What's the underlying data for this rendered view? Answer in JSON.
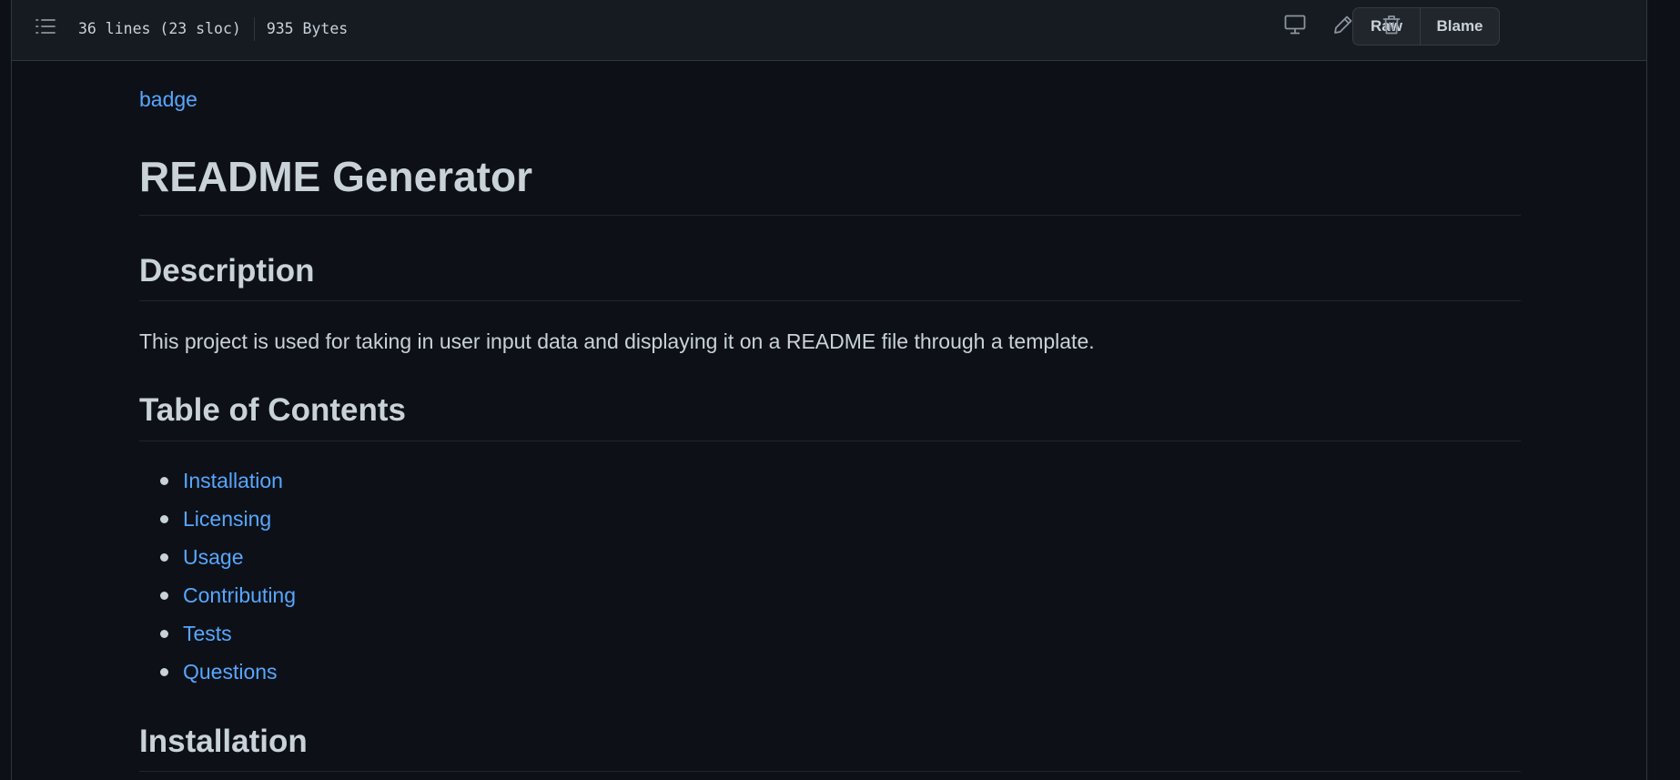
{
  "header": {
    "lines_info": "36 lines (23 sloc)",
    "size_info": "935 Bytes",
    "raw_label": "Raw",
    "blame_label": "Blame"
  },
  "readme": {
    "badge_text": "badge",
    "title": "README Generator",
    "description_heading": "Description",
    "description_text": "This project is used for taking in user input data and displaying it on a README file through a template.",
    "toc_heading": "Table of Contents",
    "toc_items": [
      {
        "label": "Installation"
      },
      {
        "label": "Licensing"
      },
      {
        "label": "Usage"
      },
      {
        "label": "Contributing"
      },
      {
        "label": "Tests"
      },
      {
        "label": "Questions"
      }
    ],
    "installation_heading": "Installation"
  },
  "colors": {
    "background": "#0d1117",
    "header_bg": "#161b22",
    "link": "#58a6ff",
    "text": "#c9d1d9"
  },
  "icons": {
    "outline": "list-unordered-icon",
    "display": "device-desktop-icon",
    "edit": "pencil-icon",
    "delete": "trash-icon"
  }
}
